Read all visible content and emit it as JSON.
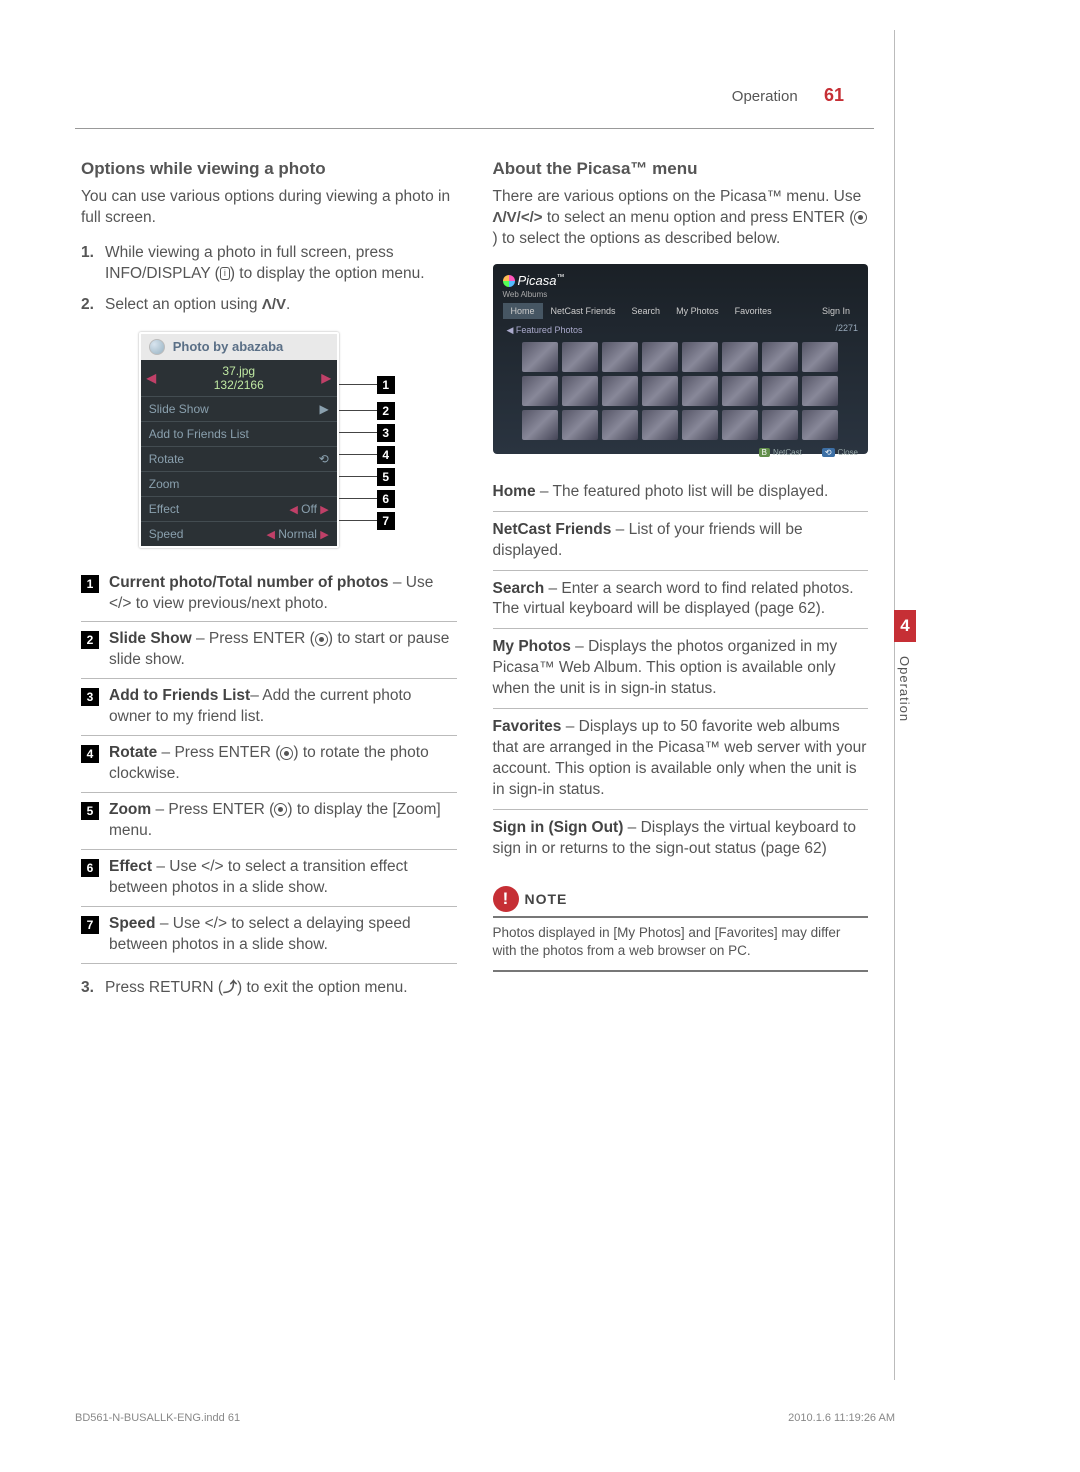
{
  "header": {
    "section_name": "Operation",
    "page_number": "61"
  },
  "side_tab": {
    "chapter": "4",
    "label": "Operation"
  },
  "left": {
    "h1": "Options while viewing a photo",
    "intro": "You can use various options during viewing a photo in full screen.",
    "steps": [
      {
        "num": "1.",
        "text_a": "While viewing a photo in full screen, press INFO/DISPLAY (",
        "text_b": ") to display the option menu."
      },
      {
        "num": "2.",
        "text_a": "Select an option using ",
        "arrows": "Λ/V",
        "text_b": "."
      },
      {
        "num": "3.",
        "text_a": "Press RETURN (",
        "text_b": ") to exit the option menu."
      }
    ],
    "photo_ui": {
      "title": "Photo by abazaba",
      "filename": "37.jpg",
      "counter": "132/2166",
      "items": [
        {
          "label": "Slide Show",
          "right": "▶"
        },
        {
          "label": "Add to Friends List",
          "right": ""
        },
        {
          "label": "Rotate",
          "right": "⟲"
        },
        {
          "label": "Zoom",
          "right": ""
        },
        {
          "label": "Effect",
          "center": "Off"
        },
        {
          "label": "Speed",
          "center": "Normal"
        }
      ]
    },
    "callouts": [
      {
        "badge": "1",
        "title": "Current photo/Total number of photos",
        "body": " – Use </> to view previous/next photo."
      },
      {
        "badge": "2",
        "title": "Slide Show",
        "body": " – Press ENTER (",
        "body2": ") to start or pause slide show."
      },
      {
        "badge": "3",
        "title": "Add to Friends List",
        "body": "– Add the current photo owner to my friend list."
      },
      {
        "badge": "4",
        "title": "Rotate",
        "body": " – Press ENTER (",
        "body2": ") to rotate the photo clockwise."
      },
      {
        "badge": "5",
        "title": "Zoom",
        "body": " – Press ENTER (",
        "body2": ") to display the [Zoom] menu."
      },
      {
        "badge": "6",
        "title": "Effect",
        "body": " – Use </> to select a transition effect between photos in a slide show."
      },
      {
        "badge": "7",
        "title": "Speed",
        "body": " – Use </> to select a delaying speed between photos in a slide show."
      }
    ]
  },
  "right": {
    "h1": "About the Picasa™ menu",
    "intro_a": "There are various options on the Picasa™ menu. Use ",
    "intro_arrows": "Λ/V/</>",
    "intro_b": " to select an menu option and press ENTER (",
    "intro_c": ") to select the options as described below.",
    "picasa": {
      "logo": "Picasa",
      "logo_sub": "Web Albums",
      "tabs": [
        "Home",
        "NetCast Friends",
        "Search",
        "My Photos",
        "Favorites",
        "Sign In"
      ],
      "strip": "Featured Photos",
      "count": "/2271",
      "footer_a": "NetCast",
      "footer_b": "Close"
    },
    "defs": [
      {
        "term": "Home",
        "body": " – The featured photo list will be displayed."
      },
      {
        "term": "NetCast Friends",
        "body": " – List of your friends will be displayed."
      },
      {
        "term": "Search",
        "body": " – Enter a search word to find related photos. The virtual keyboard will be displayed (page 62)."
      },
      {
        "term": "My Photos",
        "body": " – Displays the photos organized in my Picasa™ Web Album. This option is available only when the unit is in sign-in status."
      },
      {
        "term": "Favorites",
        "body": " – Displays up to 50 favorite web albums that are arranged in the Picasa™ web server with your account. This option is available only when the unit is in sign-in status."
      },
      {
        "term": "Sign in (Sign Out)",
        "body": " – Displays the virtual keyboard to sign in or returns to the sign-out status (page 62)"
      }
    ],
    "note": {
      "label": "NOTE",
      "body": "Photos displayed in [My Photos] and [Favorites] may differ with the photos from a web browser on PC."
    }
  },
  "footer": {
    "file": "BD561-N-BUSALLK-ENG.indd   61",
    "stamp": "2010.1.6   11:19:26 AM"
  }
}
